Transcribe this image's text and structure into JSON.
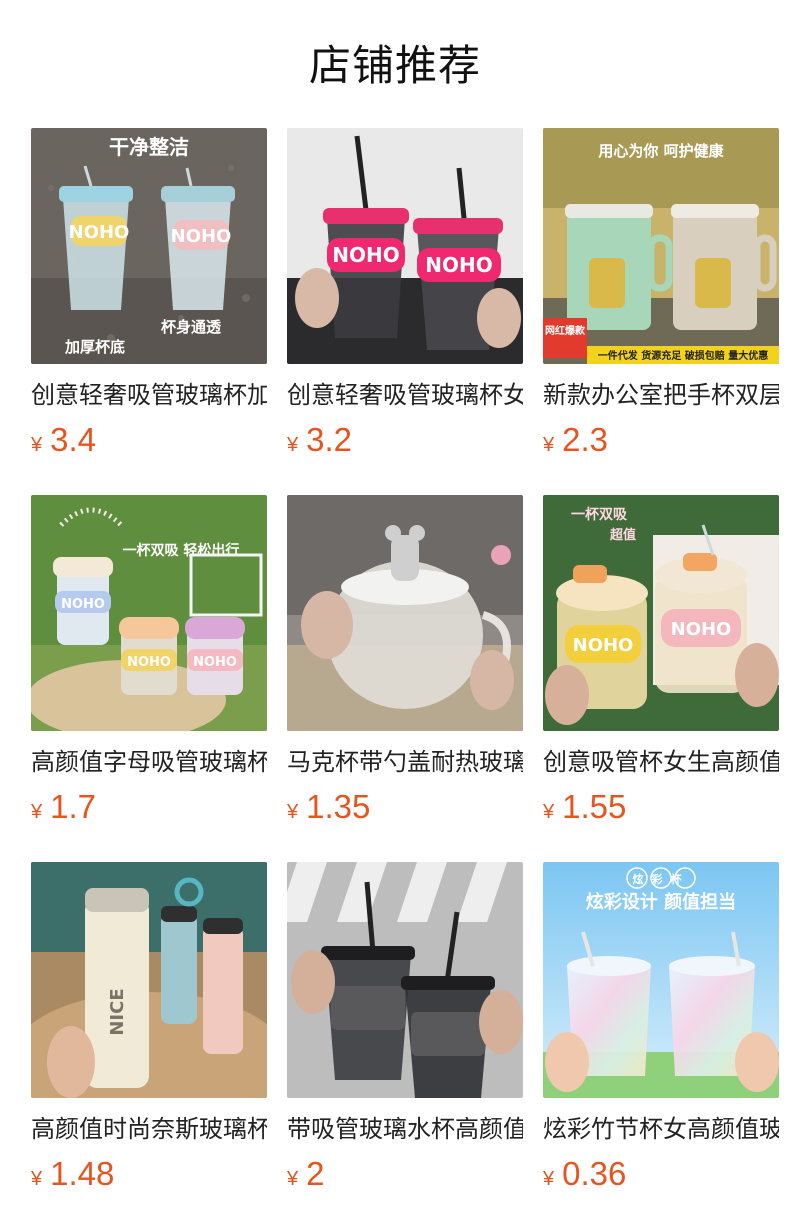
{
  "page": {
    "title": "店铺推荐",
    "currency_symbol": "¥",
    "price_color": "#e8541e"
  },
  "products": [
    {
      "title": "创意轻奢吸管玻璃杯加厚",
      "price": "3.4",
      "image_text": [
        "干净整洁",
        "加厚杯底",
        "杯身通透",
        "NOHO"
      ]
    },
    {
      "title": "创意轻奢吸管玻璃杯女生",
      "price": "3.2",
      "image_text": [
        "NOHO"
      ]
    },
    {
      "title": "新款办公室把手杯双层",
      "price": "2.3",
      "image_text": [
        "用心为你 呵护健康",
        "网红爆款",
        "一件代发 货源充足 破损包赔 量大优惠"
      ]
    },
    {
      "title": "高颜值字母吸管玻璃杯",
      "price": "1.7",
      "image_text": [
        "一杯双吸 轻松出行",
        "NOHO"
      ]
    },
    {
      "title": "马克杯带勺盖耐热玻璃杯",
      "price": "1.35",
      "image_text": []
    },
    {
      "title": "创意吸管杯女生高颜值",
      "price": "1.55",
      "image_text": [
        "一杯双吸",
        "超值",
        "NOHO"
      ]
    },
    {
      "title": "高颜值时尚奈斯玻璃杯",
      "price": "1.48",
      "image_text": [
        "NICE"
      ]
    },
    {
      "title": "带吸管玻璃水杯高颜值",
      "price": "2",
      "image_text": []
    },
    {
      "title": "炫彩竹节杯女高颜值玻璃",
      "price": "0.36",
      "image_text": [
        "炫彩杯",
        "炫彩设计 颜值担当"
      ]
    }
  ]
}
